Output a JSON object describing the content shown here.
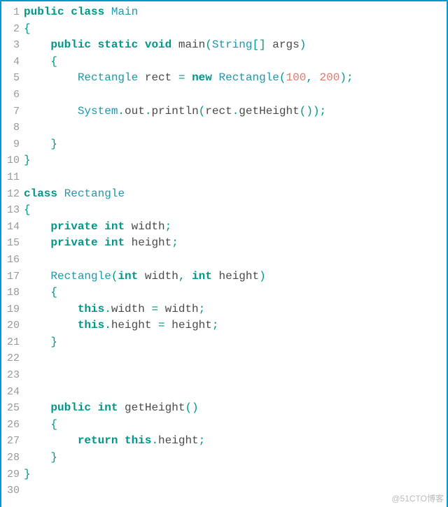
{
  "watermark": "@51CTO博客",
  "lines": [
    {
      "n": "1",
      "seg": [
        {
          "c": "kw",
          "t": "public"
        },
        {
          "c": "",
          "t": " "
        },
        {
          "c": "kw",
          "t": "class"
        },
        {
          "c": "",
          "t": " "
        },
        {
          "c": "type",
          "t": "Main"
        }
      ]
    },
    {
      "n": "2",
      "seg": [
        {
          "c": "punc",
          "t": "{"
        }
      ]
    },
    {
      "n": "3",
      "seg": [
        {
          "c": "",
          "t": "    "
        },
        {
          "c": "kw",
          "t": "public"
        },
        {
          "c": "",
          "t": " "
        },
        {
          "c": "kw",
          "t": "static"
        },
        {
          "c": "",
          "t": " "
        },
        {
          "c": "kw2",
          "t": "void"
        },
        {
          "c": "",
          "t": " main"
        },
        {
          "c": "punc",
          "t": "("
        },
        {
          "c": "type",
          "t": "String"
        },
        {
          "c": "punc",
          "t": "[]"
        },
        {
          "c": "",
          "t": " args"
        },
        {
          "c": "punc",
          "t": ")"
        }
      ]
    },
    {
      "n": "4",
      "seg": [
        {
          "c": "",
          "t": "    "
        },
        {
          "c": "punc",
          "t": "{"
        }
      ]
    },
    {
      "n": "5",
      "seg": [
        {
          "c": "",
          "t": "        "
        },
        {
          "c": "type",
          "t": "Rectangle"
        },
        {
          "c": "",
          "t": " rect "
        },
        {
          "c": "punc",
          "t": "="
        },
        {
          "c": "",
          "t": " "
        },
        {
          "c": "kw2",
          "t": "new"
        },
        {
          "c": "",
          "t": " "
        },
        {
          "c": "type",
          "t": "Rectangle"
        },
        {
          "c": "punc",
          "t": "("
        },
        {
          "c": "num",
          "t": "100"
        },
        {
          "c": "punc",
          "t": ","
        },
        {
          "c": "",
          "t": " "
        },
        {
          "c": "num",
          "t": "200"
        },
        {
          "c": "punc",
          "t": ");"
        }
      ]
    },
    {
      "n": "6",
      "seg": []
    },
    {
      "n": "7",
      "seg": [
        {
          "c": "",
          "t": "        "
        },
        {
          "c": "type",
          "t": "System"
        },
        {
          "c": "punc",
          "t": "."
        },
        {
          "c": "",
          "t": "out"
        },
        {
          "c": "punc",
          "t": "."
        },
        {
          "c": "",
          "t": "println"
        },
        {
          "c": "punc",
          "t": "("
        },
        {
          "c": "",
          "t": "rect"
        },
        {
          "c": "punc",
          "t": "."
        },
        {
          "c": "",
          "t": "getHeight"
        },
        {
          "c": "punc",
          "t": "());"
        }
      ]
    },
    {
      "n": "8",
      "seg": []
    },
    {
      "n": "9",
      "seg": [
        {
          "c": "",
          "t": "    "
        },
        {
          "c": "punc",
          "t": "}"
        }
      ]
    },
    {
      "n": "10",
      "seg": [
        {
          "c": "punc",
          "t": "}"
        }
      ]
    },
    {
      "n": "11",
      "seg": []
    },
    {
      "n": "12",
      "seg": [
        {
          "c": "kw",
          "t": "class"
        },
        {
          "c": "",
          "t": " "
        },
        {
          "c": "type",
          "t": "Rectangle"
        }
      ]
    },
    {
      "n": "13",
      "seg": [
        {
          "c": "punc",
          "t": "{"
        }
      ]
    },
    {
      "n": "14",
      "seg": [
        {
          "c": "",
          "t": "    "
        },
        {
          "c": "kw",
          "t": "private"
        },
        {
          "c": "",
          "t": " "
        },
        {
          "c": "kw2",
          "t": "int"
        },
        {
          "c": "",
          "t": " width"
        },
        {
          "c": "punc",
          "t": ";"
        }
      ]
    },
    {
      "n": "15",
      "seg": [
        {
          "c": "",
          "t": "    "
        },
        {
          "c": "kw",
          "t": "private"
        },
        {
          "c": "",
          "t": " "
        },
        {
          "c": "kw2",
          "t": "int"
        },
        {
          "c": "",
          "t": " height"
        },
        {
          "c": "punc",
          "t": ";"
        }
      ]
    },
    {
      "n": "16",
      "seg": []
    },
    {
      "n": "17",
      "seg": [
        {
          "c": "",
          "t": "    "
        },
        {
          "c": "type",
          "t": "Rectangle"
        },
        {
          "c": "punc",
          "t": "("
        },
        {
          "c": "kw2",
          "t": "int"
        },
        {
          "c": "",
          "t": " width"
        },
        {
          "c": "punc",
          "t": ","
        },
        {
          "c": "",
          "t": " "
        },
        {
          "c": "kw2",
          "t": "int"
        },
        {
          "c": "",
          "t": " height"
        },
        {
          "c": "punc",
          "t": ")"
        }
      ]
    },
    {
      "n": "18",
      "seg": [
        {
          "c": "",
          "t": "    "
        },
        {
          "c": "punc",
          "t": "{"
        }
      ]
    },
    {
      "n": "19",
      "seg": [
        {
          "c": "",
          "t": "        "
        },
        {
          "c": "kw",
          "t": "this"
        },
        {
          "c": "punc",
          "t": "."
        },
        {
          "c": "",
          "t": "width "
        },
        {
          "c": "punc",
          "t": "="
        },
        {
          "c": "",
          "t": " width"
        },
        {
          "c": "punc",
          "t": ";"
        }
      ]
    },
    {
      "n": "20",
      "seg": [
        {
          "c": "",
          "t": "        "
        },
        {
          "c": "kw",
          "t": "this"
        },
        {
          "c": "punc",
          "t": "."
        },
        {
          "c": "",
          "t": "height "
        },
        {
          "c": "punc",
          "t": "="
        },
        {
          "c": "",
          "t": " height"
        },
        {
          "c": "punc",
          "t": ";"
        }
      ]
    },
    {
      "n": "21",
      "seg": [
        {
          "c": "",
          "t": "    "
        },
        {
          "c": "punc",
          "t": "}"
        }
      ]
    },
    {
      "n": "22",
      "seg": []
    },
    {
      "n": "23",
      "seg": []
    },
    {
      "n": "24",
      "seg": []
    },
    {
      "n": "25",
      "seg": [
        {
          "c": "",
          "t": "    "
        },
        {
          "c": "kw",
          "t": "public"
        },
        {
          "c": "",
          "t": " "
        },
        {
          "c": "kw2",
          "t": "int"
        },
        {
          "c": "",
          "t": " getHeight"
        },
        {
          "c": "punc",
          "t": "()"
        }
      ]
    },
    {
      "n": "26",
      "seg": [
        {
          "c": "",
          "t": "    "
        },
        {
          "c": "punc",
          "t": "{"
        }
      ]
    },
    {
      "n": "27",
      "seg": [
        {
          "c": "",
          "t": "        "
        },
        {
          "c": "kw",
          "t": "return"
        },
        {
          "c": "",
          "t": " "
        },
        {
          "c": "kw",
          "t": "this"
        },
        {
          "c": "punc",
          "t": "."
        },
        {
          "c": "",
          "t": "height"
        },
        {
          "c": "punc",
          "t": ";"
        }
      ]
    },
    {
      "n": "28",
      "seg": [
        {
          "c": "",
          "t": "    "
        },
        {
          "c": "punc",
          "t": "}"
        }
      ]
    },
    {
      "n": "29",
      "seg": [
        {
          "c": "punc",
          "t": "}"
        }
      ]
    },
    {
      "n": "30",
      "seg": []
    }
  ]
}
